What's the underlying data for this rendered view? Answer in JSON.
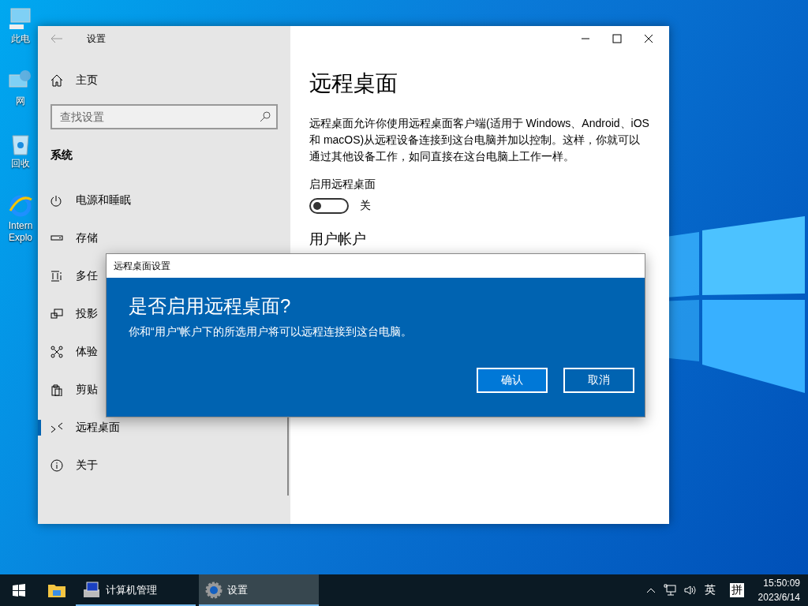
{
  "desktop": {
    "icons": [
      {
        "label": "此电"
      },
      {
        "label": "网"
      },
      {
        "label": "回收"
      },
      {
        "label": "Intern Explo"
      }
    ]
  },
  "settings_window": {
    "title": "设置",
    "sidebar": {
      "home": "主页",
      "search": {
        "placeholder": "查找设置"
      },
      "section": "系统",
      "items": [
        {
          "label": "电源和睡眠",
          "selected": false
        },
        {
          "label": "存储",
          "selected": false
        },
        {
          "label": "多任",
          "selected": false
        },
        {
          "label": "投影",
          "selected": false
        },
        {
          "label": "体验",
          "selected": false
        },
        {
          "label": "剪贴",
          "selected": false
        },
        {
          "label": "远程桌面",
          "selected": true
        },
        {
          "label": "关于",
          "selected": false
        }
      ]
    },
    "page": {
      "title": "远程桌面",
      "description": "远程桌面允许你使用远程桌面客户端(适用于 Windows、Android、iOS 和 macOS)从远程设备连接到这台电脑并加以控制。这样，你就可以通过其他设备工作，如同直接在这台电脑上工作一样。",
      "toggle": {
        "label": "启用远程桌面",
        "on": false,
        "state_text": "关"
      },
      "section_heading": "用户帐户"
    }
  },
  "dialog": {
    "title": "远程桌面设置",
    "heading": "是否启用远程桌面?",
    "message": "你和“用户”帐户下的所选用户将可以远程连接到这台电脑。",
    "buttons": [
      {
        "label": "确认",
        "primary": true
      },
      {
        "label": "取消",
        "primary": false
      }
    ]
  },
  "taskbar": {
    "apps": [
      {
        "label": "计算机管理",
        "active": false
      },
      {
        "label": "设置",
        "active": true
      }
    ],
    "tray": {
      "language": "英",
      "ime": "拼",
      "time": "15:50:09",
      "date": "2023/6/14"
    }
  }
}
